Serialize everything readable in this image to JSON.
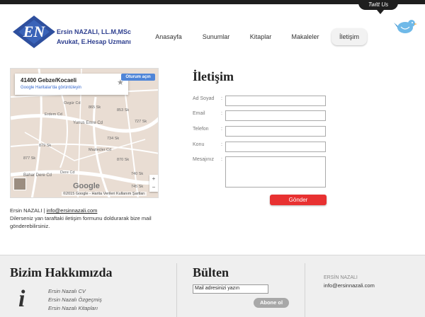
{
  "header": {
    "twitt_label": "Twitt Us",
    "brand_line1": "Ersin NAZALI, LL.M,MSc",
    "brand_line2": "Avukat, E.Hesap Uzmanı",
    "logo_text": "EN",
    "logo_color": "#2e4f9e"
  },
  "nav": {
    "items": [
      {
        "label": "Anasayfa",
        "active": false
      },
      {
        "label": "Sunumlar",
        "active": false
      },
      {
        "label": "Kitaplar",
        "active": false
      },
      {
        "label": "Makaleler",
        "active": false
      },
      {
        "label": "İletişim",
        "active": true
      }
    ]
  },
  "map": {
    "address": "41400 Gebze/Kocaeli",
    "link": "Google Haritalar'da görüntüleyin",
    "open_button": "Oturum açın",
    "brand": "Google",
    "credit": "©2015 Google - Harita Verileri   Kullanım Şartları",
    "zoom_in": "+",
    "zoom_out": "−",
    "star": "★",
    "streets": [
      "Yunus Emre Cd",
      "Bahar Dere Cd",
      "Mazlecler Cd",
      "Ozgür Cd",
      "Erdem Cd",
      "Dere Cd",
      "734 Sk",
      "870 Sk",
      "745 Sk",
      "727 Sk",
      "865 Sk",
      "879 Sk",
      "877 Sk",
      "740 Sk",
      "853 Sk"
    ]
  },
  "contact": {
    "name": "Ersin NAZALI",
    "separator": "|",
    "email": "info@ersinnazali.com",
    "description": "Dilerseniz yan taraftaki iletişim formunu doldurarak bize mail gönderebilirsiniz."
  },
  "form": {
    "title": "İletişim",
    "fields": [
      {
        "label": "Ad Soyad",
        "value": ""
      },
      {
        "label": "Email",
        "value": ""
      },
      {
        "label": "Telefon",
        "value": ""
      },
      {
        "label": "Konu",
        "value": ""
      },
      {
        "label": "Mesajınız",
        "value": ""
      }
    ],
    "colon": ":",
    "submit": "Gönder",
    "accent": "#e83131"
  },
  "footer": {
    "about_title": "Bizim Hakkımızda",
    "info_glyph": "i",
    "links": [
      "Ersin Nazalı CV",
      "Ersin Nazalı Özgeçmiş",
      "Ersin Nazalı Kitapları"
    ],
    "bulten_title": "Bülten",
    "bulten_value": "Mail adresinizi yazın",
    "abone_label": "Abone ol",
    "contact_name": "ERSİN NAZALI",
    "contact_email": "info@ersinnazali.com"
  }
}
